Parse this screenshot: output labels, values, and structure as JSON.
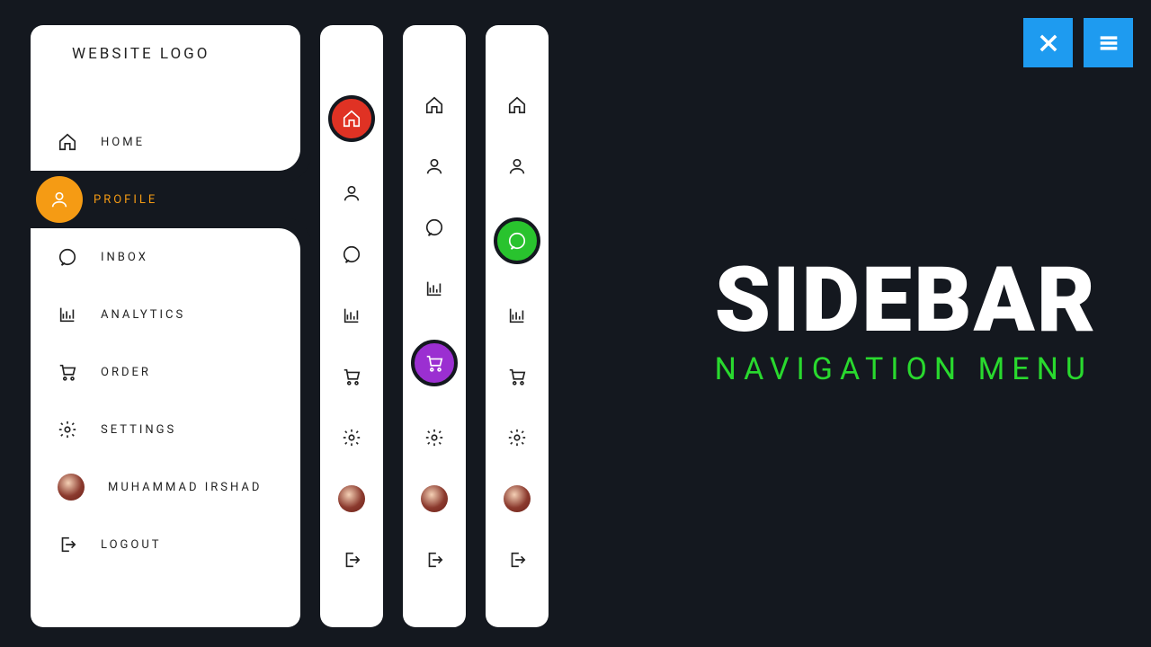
{
  "brand": {
    "logo_label": "WEBSITE LOGO"
  },
  "menu": {
    "items": [
      {
        "key": "home",
        "label": "HOME",
        "icon": "home-icon"
      },
      {
        "key": "profile",
        "label": "PROFILE",
        "icon": "user-icon"
      },
      {
        "key": "inbox",
        "label": "INBOX",
        "icon": "chat-icon"
      },
      {
        "key": "analytics",
        "label": "ANALYTICS",
        "icon": "chart-icon"
      },
      {
        "key": "order",
        "label": "ORDER",
        "icon": "cart-icon"
      },
      {
        "key": "settings",
        "label": "SETTINGS",
        "icon": "gear-icon"
      },
      {
        "key": "user",
        "label": "MUHAMMAD IRSHAD",
        "icon": "avatar"
      },
      {
        "key": "logout",
        "label": "LOGOUT",
        "icon": "logout-icon"
      }
    ]
  },
  "active": {
    "expanded": "profile",
    "mini1": "home",
    "mini2": "order",
    "mini3": "inbox"
  },
  "accent": {
    "profile": "#f59b14",
    "home": "#e03224",
    "order": "#9b2fd1",
    "inbox": "#29c32e"
  },
  "headline": {
    "title": "SIDEBAR",
    "subtitle": "NAVIGATION MENU"
  },
  "controls": {
    "close": "close",
    "menu": "menu"
  }
}
